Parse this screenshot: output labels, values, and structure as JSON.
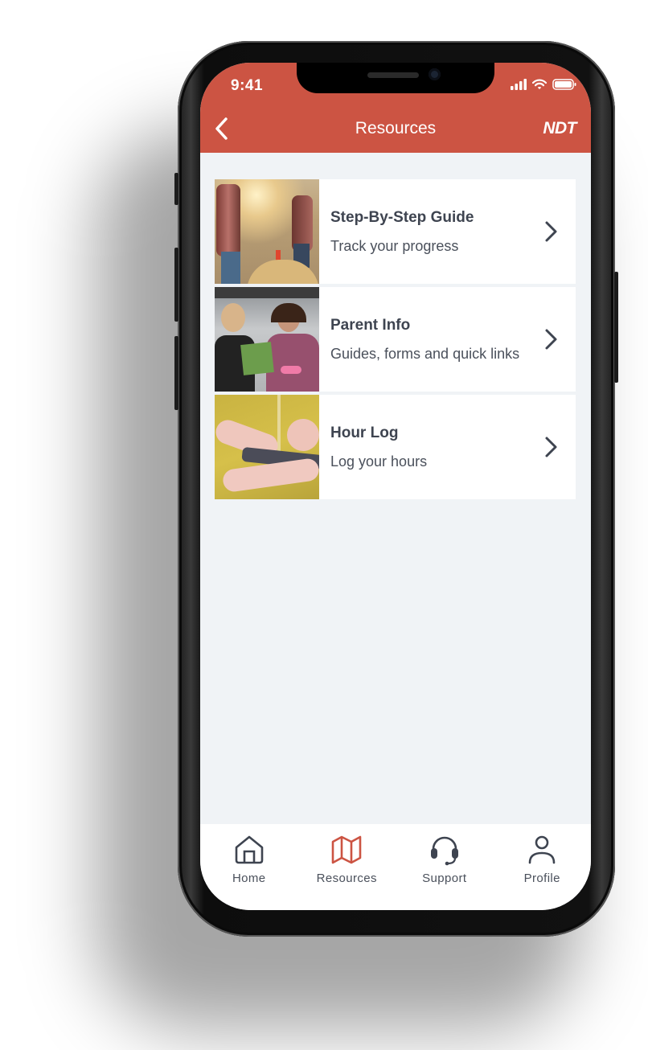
{
  "colors": {
    "brand": "#cc5443",
    "background": "#f0f3f6",
    "text_dark": "#3e4450",
    "active_tab": "#cc5443"
  },
  "status_bar": {
    "time": "9:41",
    "icons": [
      "cellular-signal-icon",
      "wifi-icon",
      "battery-icon"
    ]
  },
  "header": {
    "title": "Resources",
    "back_icon": "chevron-left-icon",
    "logo": "NDT"
  },
  "resources": [
    {
      "title": "Step-By-Step Guide",
      "subtitle": "Track your progress",
      "image": "driving-lesson-photo",
      "icon": "chevron-right-icon"
    },
    {
      "title": "Parent Info",
      "subtitle": "Guides, forms and quick links",
      "image": "parent-and-teen-photo",
      "icon": "chevron-right-icon"
    },
    {
      "title": "Hour Log",
      "subtitle": "Log your hours",
      "image": "phone-in-hands-photo",
      "icon": "chevron-right-icon"
    }
  ],
  "tabbar": {
    "active": "Resources",
    "tabs": [
      {
        "label": "Home",
        "icon": "home-icon"
      },
      {
        "label": "Resources",
        "icon": "map-icon"
      },
      {
        "label": "Support",
        "icon": "headset-icon"
      },
      {
        "label": "Profile",
        "icon": "user-icon"
      }
    ]
  }
}
